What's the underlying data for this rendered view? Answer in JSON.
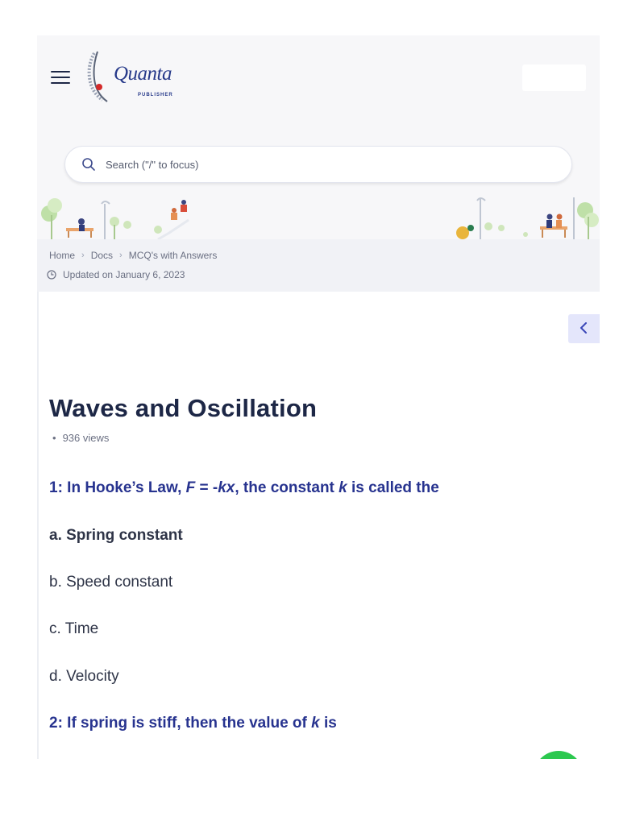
{
  "header": {
    "logo": {
      "name": "Quanta",
      "sub": "PUBLISHER"
    },
    "search_placeholder": "Search (\"/\" to focus)"
  },
  "breadcrumb": {
    "items": [
      "Home",
      "Docs",
      "MCQ's with Answers"
    ],
    "updated": "Updated on January 6, 2023"
  },
  "article": {
    "title": "Waves and Oscillation",
    "views": "936 views",
    "q1": {
      "prefix": "1: In Hooke’s Law, ",
      "formula_f": "F",
      "formula_eq": " = -",
      "formula_kx": "kx",
      "mid": ", the constant ",
      "k": "k",
      "suffix": " is called the"
    },
    "options": [
      {
        "letter": "a. ",
        "text": "Spring constant"
      },
      {
        "letter": "b. ",
        "text": "Speed constant"
      },
      {
        "letter": "c. ",
        "text": "Time"
      },
      {
        "letter": "d. ",
        "text": "Velocity"
      }
    ],
    "q2": {
      "prefix": "2: If spring is stiff, then the value of ",
      "k": "k",
      "suffix": " is"
    }
  },
  "colors": {
    "accent": "#27338f",
    "title": "#1d2746",
    "fab": "#2cc84f",
    "toc": "#e4e6fb"
  },
  "icons": [
    "menu-icon",
    "search-icon",
    "chevron-right-icon",
    "clock-icon",
    "chevron-left-icon",
    "whatsapp-icon"
  ]
}
